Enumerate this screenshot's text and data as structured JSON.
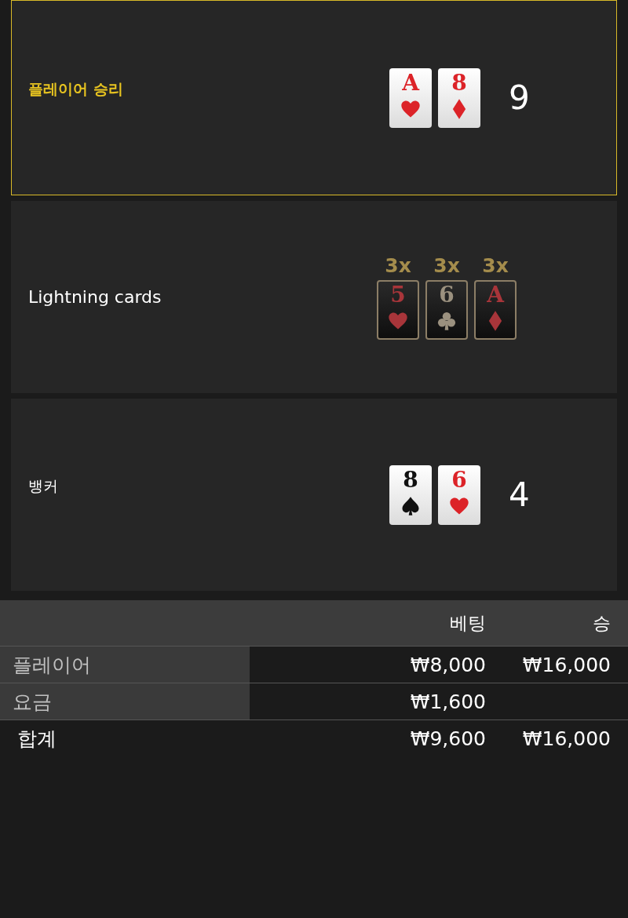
{
  "rows": [
    {
      "kind": "hand",
      "label": "플레이어 승리",
      "selected": true,
      "cards": [
        {
          "rank": "A",
          "kind": "hearts"
        },
        {
          "rank": "8",
          "kind": "diamonds"
        }
      ],
      "total": "9"
    },
    {
      "kind": "lightning",
      "label": "Lightning cards",
      "cards": [
        {
          "multiplier": "3x",
          "rank": "5",
          "kind": "hearts"
        },
        {
          "multiplier": "3x",
          "rank": "6",
          "kind": "clubs"
        },
        {
          "multiplier": "3x",
          "rank": "A",
          "kind": "diamonds"
        }
      ]
    },
    {
      "kind": "hand",
      "label": "뱅커",
      "selected": false,
      "cards": [
        {
          "rank": "8",
          "kind": "spades"
        },
        {
          "rank": "6",
          "kind": "hearts"
        }
      ],
      "total": "4"
    }
  ],
  "table": {
    "columns": [
      "베팅",
      "승"
    ],
    "rows": [
      {
        "label": "플레이어",
        "bet": "₩8,000",
        "win": "₩16,000"
      },
      {
        "label": "요금",
        "bet": "₩1,600"
      }
    ],
    "total": {
      "label": "합계",
      "bet": "₩9,600",
      "win": "₩16,000"
    }
  }
}
